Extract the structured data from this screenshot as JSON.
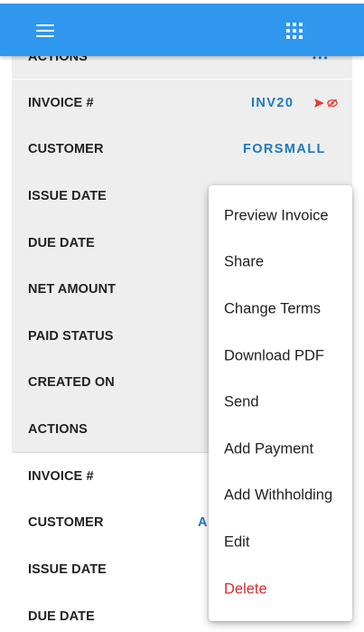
{
  "appbar": {
    "menu_icon": "hamburger-menu-icon",
    "apps_icon": "apps-grid-icon",
    "background": "#2f97ee"
  },
  "invoices": [
    {
      "labels": {
        "actions": "ACTIONS"
      }
    },
    {
      "labels": {
        "invoice_no": "INVOICE #",
        "customer": "CUSTOMER",
        "issue_date": "ISSUE DATE",
        "due_date": "DUE DATE",
        "net_amount": "NET AMOUNT",
        "paid_status": "PAID STATUS",
        "created_on": "CREATED ON",
        "actions": "ACTIONS"
      },
      "invoice_no": "INV20",
      "customer": "FORSMALL",
      "icons": [
        "send-icon",
        "eye-off-icon"
      ]
    },
    {
      "labels": {
        "invoice_no": "INVOICE #",
        "customer": "CUSTOMER",
        "issue_date": "ISSUE DATE",
        "due_date": "DUE DATE"
      },
      "customer_partial": "A"
    }
  ],
  "action_menu": {
    "items": [
      {
        "label": "Preview Invoice"
      },
      {
        "label": "Share"
      },
      {
        "label": "Change Terms"
      },
      {
        "label": "Download PDF"
      },
      {
        "label": "Send"
      },
      {
        "label": "Add Payment"
      },
      {
        "label": "Add Withholding"
      },
      {
        "label": "Edit"
      },
      {
        "label": "Delete",
        "color": "#d32f2f"
      }
    ]
  },
  "colors": {
    "accent": "#1e79c2",
    "danger": "#d32f2f",
    "card_grey": "#eeeeee"
  }
}
